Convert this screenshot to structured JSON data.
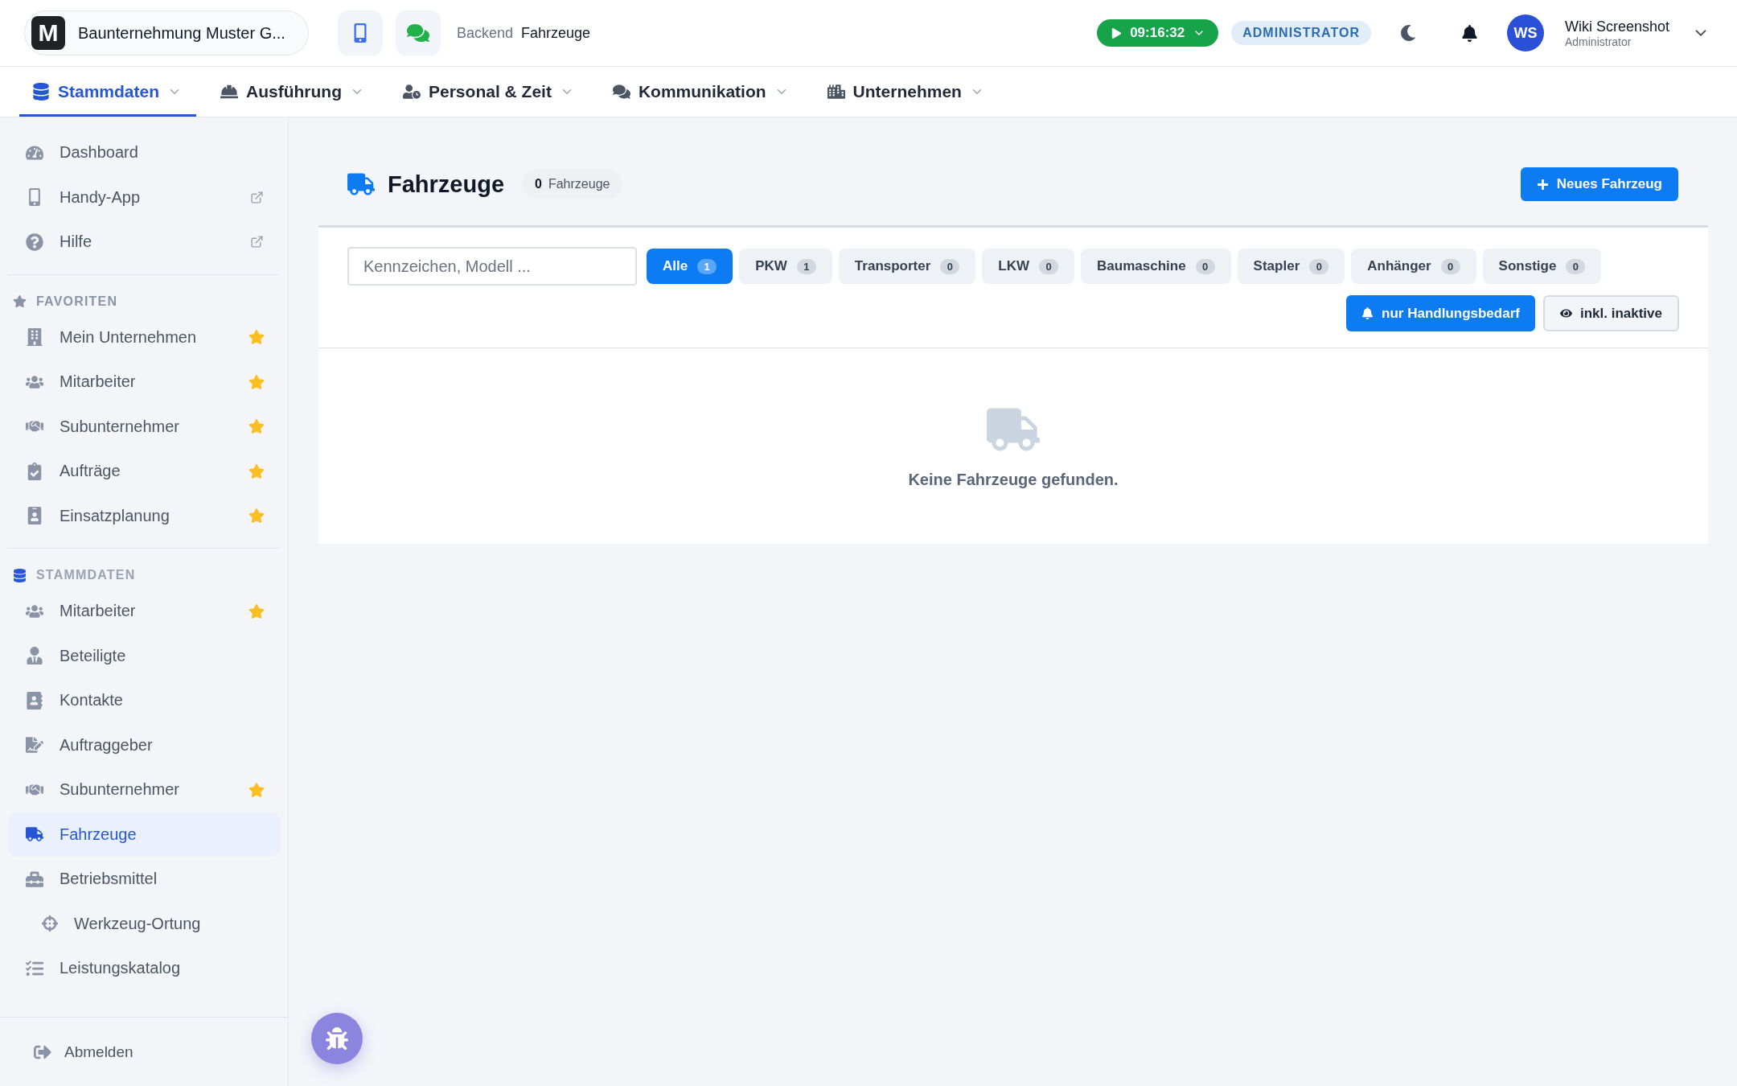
{
  "header": {
    "logo_letter": "M",
    "company": "Baunternehmung Muster G...",
    "breadcrumb": [
      "Backend",
      "Fahrzeuge"
    ],
    "timer": "09:16:32",
    "role": "ADMINISTRATOR",
    "user": {
      "initials": "WS",
      "name": "Wiki Screenshot",
      "role": "Administrator"
    }
  },
  "nav": [
    {
      "label": "Stammdaten",
      "selected": true
    },
    {
      "label": "Ausführung",
      "selected": false
    },
    {
      "label": "Personal & Zeit",
      "selected": false
    },
    {
      "label": "Kommunikation",
      "selected": false
    },
    {
      "label": "Unternehmen",
      "selected": false
    }
  ],
  "sidebar": {
    "top_items": [
      {
        "label": "Dashboard",
        "external": false
      },
      {
        "label": "Handy-App",
        "external": true
      },
      {
        "label": "Hilfe",
        "external": true
      }
    ],
    "sections": [
      {
        "title": "FAVORITEN",
        "active": false,
        "items": [
          {
            "label": "Mein Unternehmen",
            "favorite": true,
            "selected": false
          },
          {
            "label": "Mitarbeiter",
            "favorite": true,
            "selected": false
          },
          {
            "label": "Subunternehmer",
            "favorite": true,
            "selected": false
          },
          {
            "label": "Aufträge",
            "favorite": true,
            "selected": false
          },
          {
            "label": "Einsatzplanung",
            "favorite": true,
            "selected": false
          }
        ]
      },
      {
        "title": "STAMMDATEN",
        "active": true,
        "items": [
          {
            "label": "Mitarbeiter",
            "favorite": true,
            "selected": false
          },
          {
            "label": "Beteiligte",
            "favorite": false,
            "selected": false
          },
          {
            "label": "Kontakte",
            "favorite": false,
            "selected": false
          },
          {
            "label": "Auftraggeber",
            "favorite": false,
            "selected": false
          },
          {
            "label": "Subunternehmer",
            "favorite": true,
            "selected": false
          },
          {
            "label": "Fahrzeuge",
            "favorite": false,
            "selected": true
          },
          {
            "label": "Betriebsmittel",
            "favorite": false,
            "selected": false,
            "children": [
              {
                "label": "Werkzeug-Ortung",
                "favorite": false,
                "selected": false
              }
            ]
          },
          {
            "label": "Leistungskatalog",
            "favorite": false,
            "selected": false
          }
        ]
      }
    ],
    "logout": "Abmelden"
  },
  "page": {
    "title": "Fahrzeuge",
    "count": "0",
    "count_label": "Fahrzeuge",
    "new_button": "Neues Fahrzeug",
    "search": {
      "placeholder": "Kennzeichen, Modell ..."
    },
    "filters": [
      {
        "label": "Alle",
        "count": "1",
        "selected": true
      },
      {
        "label": "PKW",
        "count": "1",
        "selected": false
      },
      {
        "label": "Transporter",
        "count": "0",
        "selected": false
      },
      {
        "label": "LKW",
        "count": "0",
        "selected": false
      },
      {
        "label": "Baumaschine",
        "count": "0",
        "selected": false
      },
      {
        "label": "Stapler",
        "count": "0",
        "selected": false
      },
      {
        "label": "Anhänger",
        "count": "0",
        "selected": false
      },
      {
        "label": "Sonstige",
        "count": "0",
        "selected": false
      }
    ],
    "toggles": [
      {
        "label": "nur Handlungsbedarf",
        "on": true
      },
      {
        "label": "inkl. inaktive",
        "on": false
      }
    ],
    "empty": "Keine Fahrzeuge gefunden."
  }
}
